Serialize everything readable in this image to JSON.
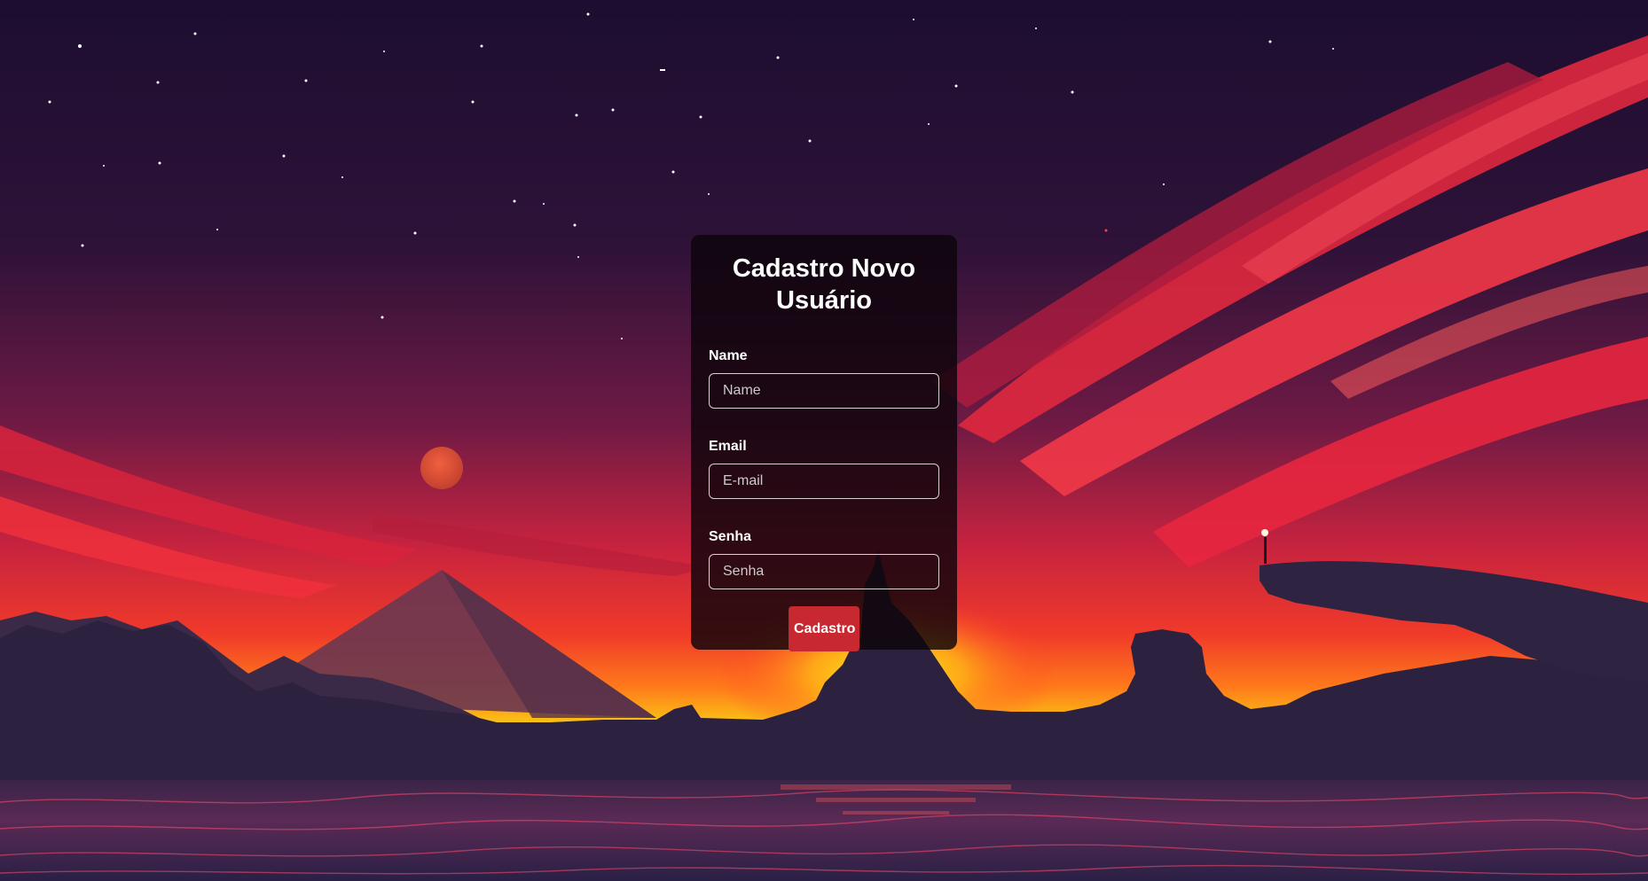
{
  "form": {
    "title": "Cadastro Novo Usuário",
    "name_label": "Name",
    "name_placeholder": "Name",
    "name_value": "",
    "email_label": "Email",
    "email_placeholder": "E-mail",
    "email_value": "",
    "password_label": "Senha",
    "password_placeholder": "Senha",
    "password_value": "",
    "submit_label": "Cadastro"
  },
  "colors": {
    "card_background": "#0c040a",
    "submit_button": "#c8282f",
    "sky_top": "#1f0f33",
    "sky_red": "#e8263f",
    "sun_glow": "#f5e612",
    "terrain": "#2c2240"
  }
}
